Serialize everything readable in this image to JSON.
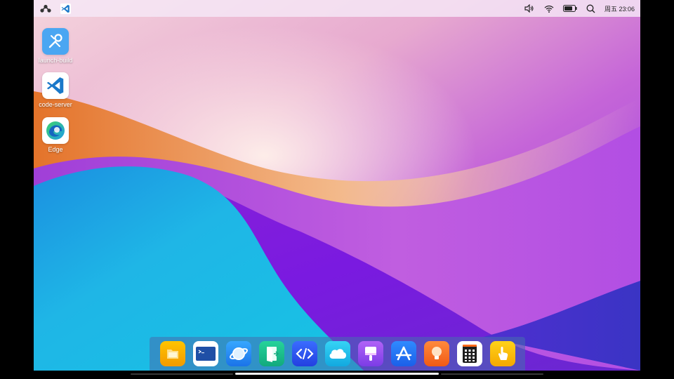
{
  "statusbar": {
    "clock": "周五 23:06",
    "icons": [
      "launcher-icon",
      "vscode-tray-icon",
      "volume-icon",
      "wifi-icon",
      "battery-icon",
      "search-icon"
    ],
    "battery_level_percent": 75
  },
  "desktop": {
    "items": [
      {
        "label": "launch-build",
        "icon": "wrench-icon"
      },
      {
        "label": "code-server",
        "icon": "vscode-icon"
      },
      {
        "label": "Edge",
        "icon": "edge-icon"
      }
    ]
  },
  "dock": {
    "apps": [
      {
        "icon": "files-icon",
        "color": "#f7a700"
      },
      {
        "icon": "terminal-icon",
        "color": "#1b4fa8"
      },
      {
        "icon": "browser-icon",
        "color": "#2f8df1"
      },
      {
        "icon": "exit-door-icon",
        "color": "#17b98a"
      },
      {
        "icon": "code-editor-icon",
        "color": "#2e55f0"
      },
      {
        "icon": "cloud-icon",
        "color": "#1bb8e8"
      },
      {
        "icon": "paint-brush-icon",
        "color": "#9b4ee8"
      },
      {
        "icon": "app-store-icon",
        "color": "#1e6ff0"
      },
      {
        "icon": "lightbulb-icon",
        "color": "#f56a1e"
      },
      {
        "icon": "calculator-icon",
        "color": "#222222"
      },
      {
        "icon": "touch-icon",
        "color": "#f7b500"
      }
    ]
  }
}
